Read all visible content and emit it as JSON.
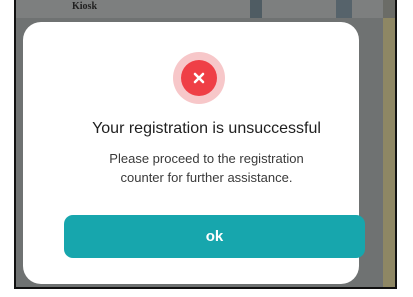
{
  "background": {
    "kiosk_label": "Kiosk"
  },
  "dialog": {
    "icon": "close-circle-icon",
    "title": "Your registration is unsuccessful",
    "message_lines": [
      "Please proceed to the registration",
      "counter for further assistance."
    ],
    "ok_label": "ok"
  },
  "colors": {
    "accent": "#17a6ad",
    "error": "#ef3f46",
    "error_ring": "#f7c7c9",
    "overlay": "#6f7272"
  }
}
